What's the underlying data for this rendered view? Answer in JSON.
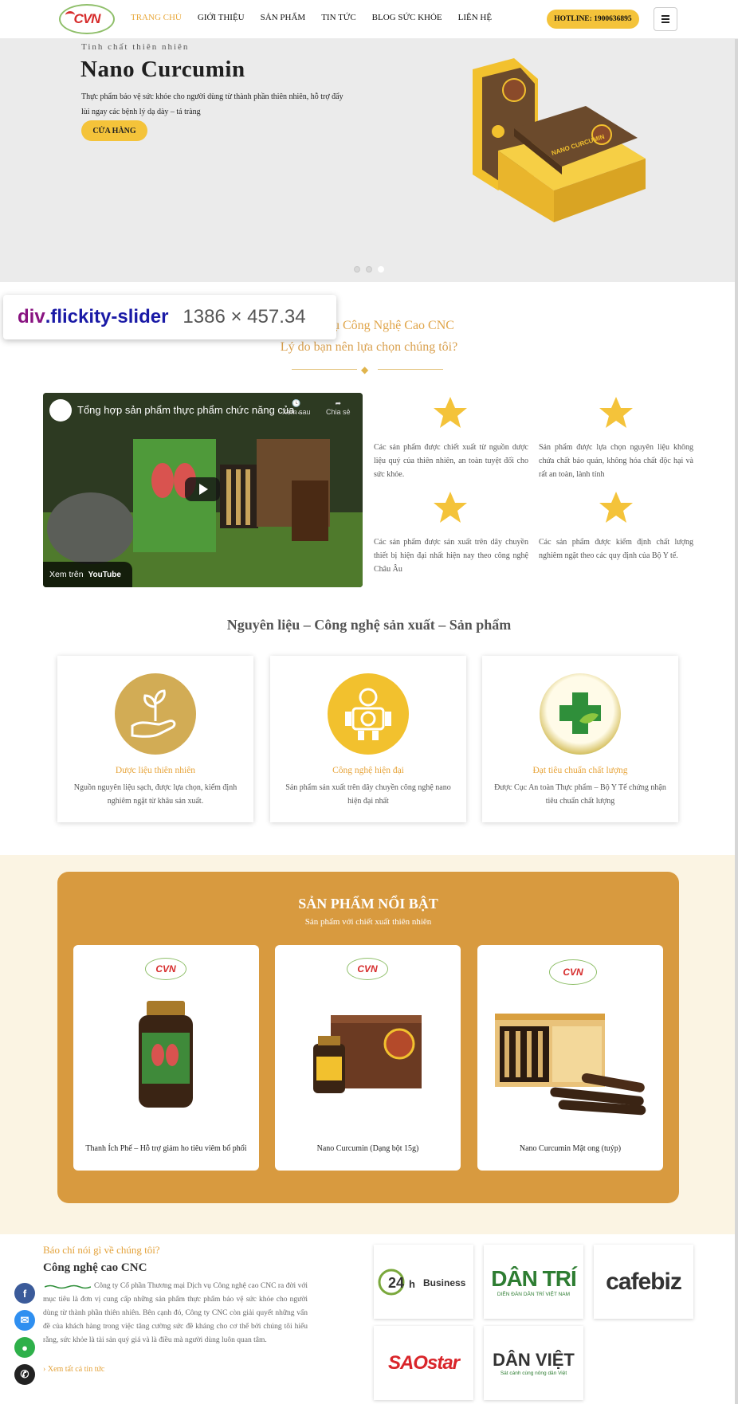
{
  "header": {
    "logo_text": "CVN",
    "nav": [
      "TRANG CHỦ",
      "GIỚI THIỆU",
      "SẢN PHẨM",
      "TIN TỨC",
      "BLOG SỨC KHỎE",
      "LIÊN HỆ"
    ],
    "active_nav": "TRANG CHỦ",
    "hotline": "HOTLINE: 1900636895"
  },
  "hero": {
    "tagline": "Tinh chất thiên nhiên",
    "title": "Nano Curcumin",
    "description": "Thực phẩm bảo vệ sức khỏe cho người dùng từ thành phần thiên nhiên, hỗ trợ đẩy lùi ngay các bệnh lý dạ dày – tá tràng",
    "button": "CỬA HÀNG",
    "box_label": "NANO CURCUMIN",
    "slides": 3,
    "active_slide": 3
  },
  "inspector": {
    "tag": "div",
    "class": ".flickity-slider",
    "size": "1386 × 457.34"
  },
  "intro": {
    "line1": "ại Dịch Vụ Công Nghệ Cao CNC",
    "line2": "Lý do bạn nên lựa chọn chúng tôi?"
  },
  "video": {
    "title": "Tổng hợp sản phẩm thực phẩm chức năng của...",
    "watch_later": "Xem sau",
    "share": "Chia sẻ",
    "watch_on": "Xem trên",
    "platform": "YouTube"
  },
  "features": [
    "Các sản phẩm được chiết xuất từ nguồn dược liệu quý của thiên nhiên, an toàn tuyệt đối cho sức khỏe.",
    "Sản phẩm được lựa chọn nguyên liệu không chứa chất bảo quản, không hóa chất độc hại và rất an toàn, lành tính",
    "Các sản phẩm được sản xuất trên dây chuyền thiết bị hiện đại nhất hiện nay theo công nghệ Châu Âu",
    "Các sản phẩm được kiểm định chất lượng nghiêm ngặt theo các quy định của Bộ Y tế."
  ],
  "section2": {
    "title": "Nguyên liệu – Công nghệ sản xuất – Sản phẩm",
    "cards": [
      {
        "title": "Dược liệu thiên nhiên",
        "desc": "Nguồn nguyên liệu sạch, được lựa chọn, kiểm định nghiêm ngặt từ khâu sản xuất."
      },
      {
        "title": "Công nghệ hiện đại",
        "desc": "Sản phẩm sản xuất trên dây chuyền công nghệ nano hiện đại nhất"
      },
      {
        "title": "Đạt tiêu chuẩn chất lượng",
        "desc": "Được Cục An toàn Thực phẩm – Bộ Y Tế chứng nhận tiêu chuẩn chất lượng"
      }
    ]
  },
  "featured": {
    "title": "SẢN PHẨM NỔI BẬT",
    "subtitle": "Sản phẩm với chiết xuất thiên nhiên",
    "products": [
      "Thanh Ích Phế – Hỗ trợ giảm ho tiêu viêm bổ phổi",
      "Nano Curcumin (Dạng bột 15g)",
      "Nano Curcumin Mật ong (tuýp)"
    ]
  },
  "press": {
    "kicker": "Báo chí nói gì về chúng tôi?",
    "title": "Công nghệ cao CNC",
    "body": "Công ty Cổ phần Thương mại Dịch vụ Công nghệ cao CNC ra đời với mục tiêu là đơn vị cung cấp những sản phẩm thực phẩm bảo vệ sức khỏe cho người dùng từ thành phần thiên nhiên. Bên cạnh đó, Công ty CNC còn giải quyết những vấn đề của khách hàng trong việc tăng cường sức đề kháng cho cơ thể bởi chúng tôi hiểu rằng, sức khỏe là tài sản quý giá và là điều mà người dùng luôn quan tâm.",
    "link": "Xem tất cả tin tức",
    "logos": [
      "24h Business",
      "DÂN TRÍ",
      "cafebiz",
      "SAOstar",
      "DÂN VIỆT"
    ],
    "logo_sub": {
      "dantri": "DIỄN ĐÀN DÂN TRÍ VIỆT NAM",
      "danviet": "Sát cánh cùng nông dân Việt"
    }
  },
  "colors": {
    "accent": "#f4c33a",
    "gold": "#d89a3f",
    "orange_text": "#e3a23a"
  }
}
